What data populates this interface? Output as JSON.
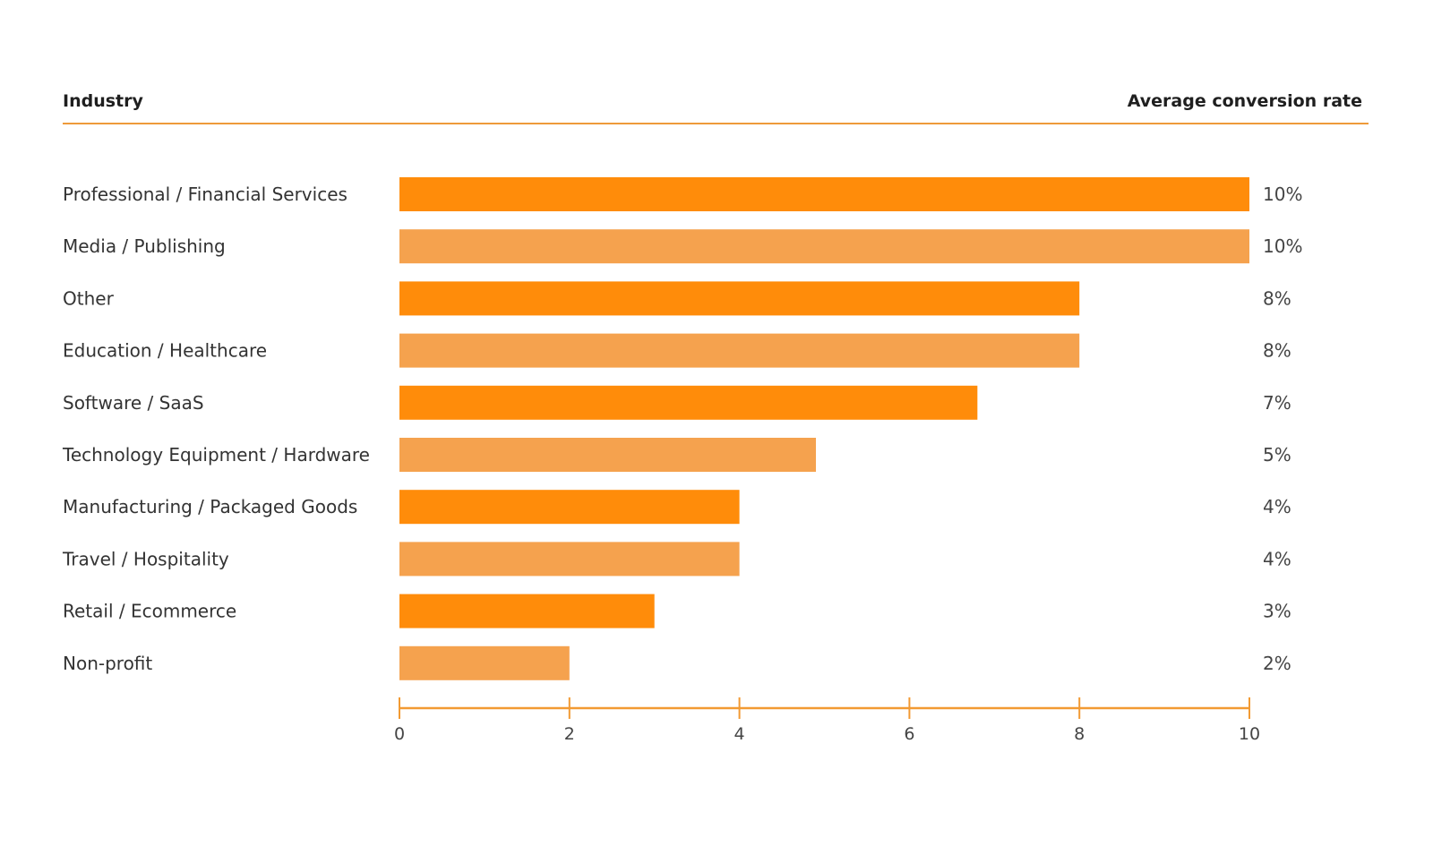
{
  "chart_data": {
    "type": "bar",
    "orientation": "horizontal",
    "title": "",
    "header_left": "Industry",
    "header_right": "Average conversion rate",
    "categories": [
      "Professional / Financial Services",
      "Media / Publishing",
      "Other",
      "Education / Healthcare",
      "Software / SaaS",
      "Technology Equipment / Hardware",
      "Manufacturing / Packaged Goods",
      "Travel / Hospitality",
      "Retail / Ecommerce",
      "Non-profit"
    ],
    "values": [
      10.0,
      10.0,
      8.0,
      8.0,
      6.8,
      4.9,
      4.0,
      4.0,
      3.0,
      2.0
    ],
    "value_labels": [
      "10%",
      "10%",
      "8%",
      "8%",
      "7%",
      "5%",
      "4%",
      "4%",
      "3%",
      "2%"
    ],
    "xlabel": "",
    "ylabel": "",
    "xlim": [
      0,
      10
    ],
    "x_ticks": [
      0,
      2,
      4,
      6,
      8,
      10
    ],
    "x_tick_labels": [
      "0",
      "2",
      "4",
      "6",
      "8",
      "10"
    ],
    "grid": false,
    "legend": "none",
    "colors": {
      "bar_primary": "#FF8C0A",
      "bar_secondary": "#F5A24E",
      "axis": "#F29A33",
      "header_rule": "#EE9A3A"
    }
  }
}
